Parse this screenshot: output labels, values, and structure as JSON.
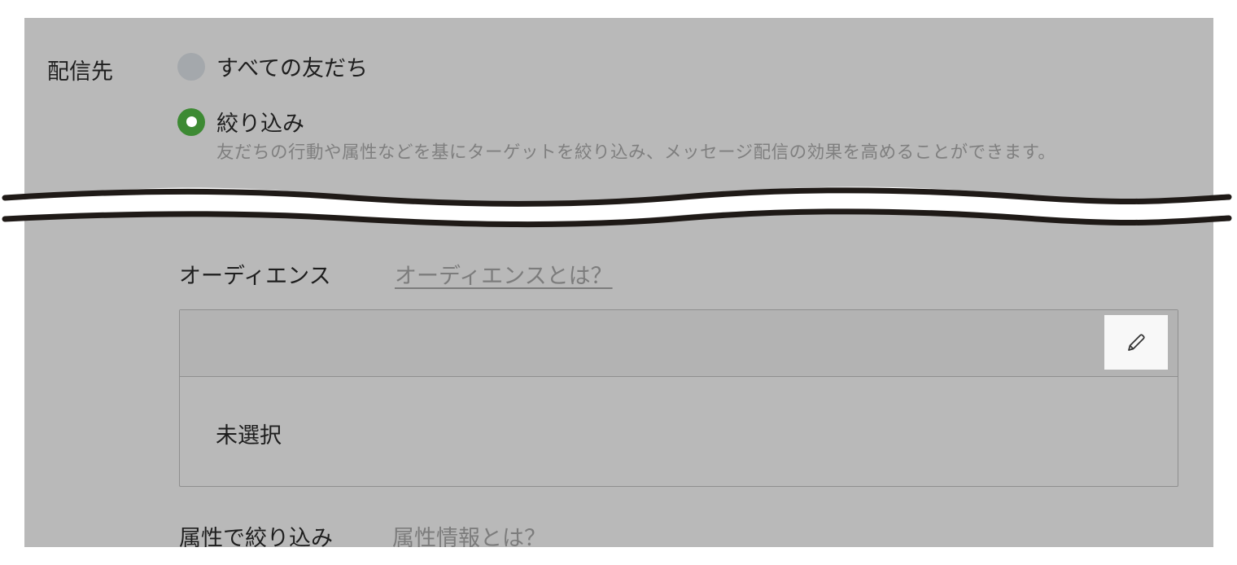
{
  "delivery": {
    "label": "配信先",
    "options": [
      {
        "label": "すべての友だち",
        "selected": false
      },
      {
        "label": "絞り込み",
        "selected": true
      }
    ],
    "filter_description": "友だちの行動や属性などを基にターゲットを絞り込み、メッセージ配信の効果を高めることができます。"
  },
  "audience": {
    "title": "オーディエンス",
    "help_link": "オーディエンスとは？",
    "edit_icon": "pencil-icon",
    "value": "未選択"
  },
  "attribute": {
    "title": "属性で絞り込み",
    "help_link": "属性情報とは？"
  },
  "colors": {
    "overlay": "#b9b9b9",
    "radio_selected": "#3d8a33",
    "radio_unselected": "#a4a8ac"
  }
}
